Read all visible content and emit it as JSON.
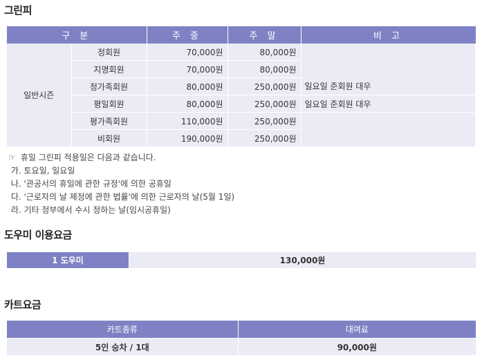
{
  "greenfee": {
    "title": "그린피",
    "headers": {
      "category": "구 분",
      "weekday": "주 중",
      "weekend": "주 말",
      "note": "비 고"
    },
    "season": "일반시즌",
    "rows": [
      {
        "type": "정회원",
        "weekday": "70,000원",
        "weekend": "80,000원",
        "note": ""
      },
      {
        "type": "지명회원",
        "weekday": "70,000원",
        "weekend": "80,000원",
        "note": ""
      },
      {
        "type": "정가족회원",
        "weekday": "80,000원",
        "weekend": "250,000원",
        "note": "일요일 준회원 대우"
      },
      {
        "type": "평일회원",
        "weekday": "80,000원",
        "weekend": "250,000원",
        "note": "일요일 준회원 대우"
      },
      {
        "type": "평가족회원",
        "weekday": "110,000원",
        "weekend": "250,000원",
        "note": ""
      },
      {
        "type": "비회원",
        "weekday": "190,000원",
        "weekend": "250,000원",
        "note": ""
      }
    ],
    "notes": {
      "icon": "pointing-hand-icon",
      "intro": "휴일 그린피 적용일은 다음과 같습니다.",
      "items": [
        " 가. 토요일, 일요일",
        " 나. '관공서의 휴일에 관한 규정'에 의한 공휴일",
        " 다. '근로자의 날 제정에 관한 법률'에 의한 근로자의 날(5월 1일)",
        " 라. 기타 정부에서 수시 정하는 날(임시공휴일)"
      ]
    }
  },
  "domi": {
    "title": "도우미 이용요금",
    "label": "1 도우미",
    "value": "130,000원"
  },
  "cart": {
    "title": "카트요금",
    "headers": {
      "kind": "카트종류",
      "fee": "대여료"
    },
    "row": {
      "kind": "5인 승차 / 1대",
      "fee": "90,000원"
    }
  },
  "colors": {
    "header_bg": "#7e82c4",
    "cell_bg": "#ebebf6"
  }
}
